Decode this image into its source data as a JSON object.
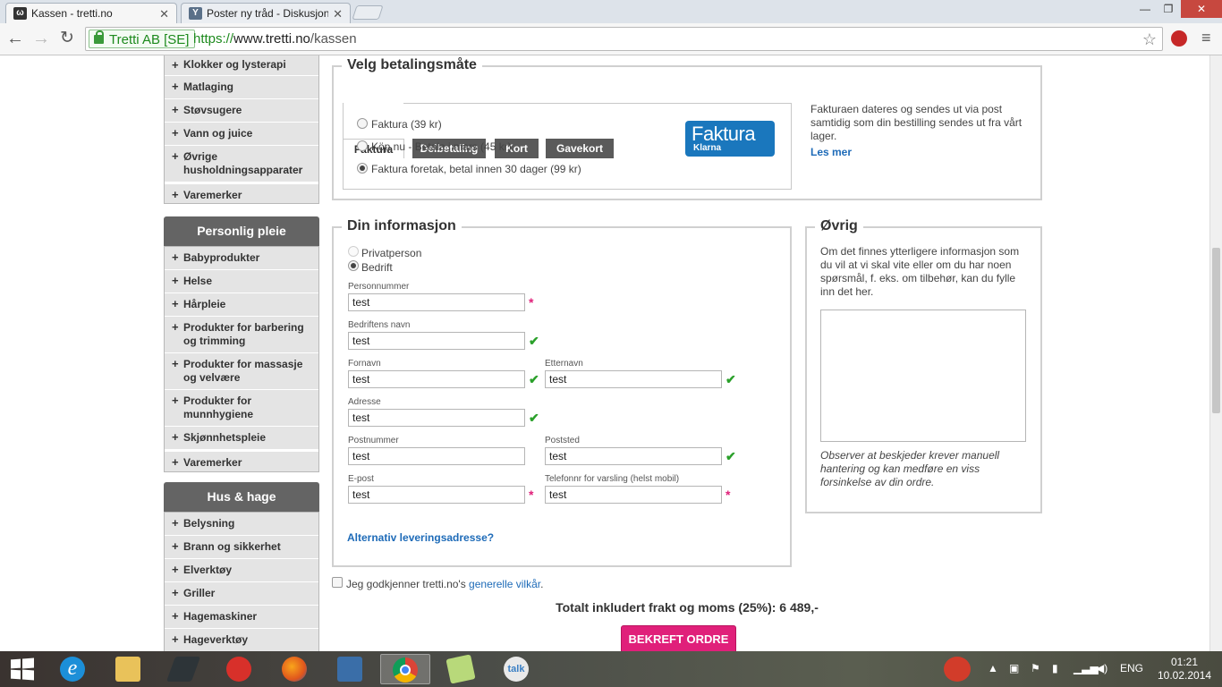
{
  "browser": {
    "tabs": [
      {
        "title": "Kassen - tretti.no",
        "active": true
      },
      {
        "title": "Poster ny tråd - Diskusjon",
        "active": false
      }
    ],
    "window_controls": {
      "minimize": "—",
      "restore": "❐",
      "close": "✕"
    },
    "address": {
      "ev_label": "Tretti AB [SE]",
      "scheme": "https://",
      "host": "www.tretti.no",
      "path": "/kassen"
    }
  },
  "sidebar": {
    "group1_items": [
      "Klokker og lysterapi",
      "Matlaging",
      "Støvsugere",
      "Vann og juice",
      "Øvrige husholdningsapparater"
    ],
    "group1_brands": "Varemerker",
    "group2_title": "Personlig pleie",
    "group2_items": [
      "Babyprodukter",
      "Helse",
      "Hårpleie",
      "Produkter for barbering og trimming",
      "Produkter for massasje og velvære",
      "Produkter for munnhygiene",
      "Skjønnhetspleie"
    ],
    "group2_brands": "Varemerker",
    "group3_title": "Hus & hage",
    "group3_items": [
      "Belysning",
      "Brann og sikkerhet",
      "Elverktøy",
      "Griller",
      "Hagemaskiner",
      "Hageverktøy"
    ]
  },
  "payment": {
    "legend": "Velg betalingsmåte",
    "tabs": [
      "Faktura",
      "Delbetaling",
      "Kort",
      "Gavekort"
    ],
    "active_tab": "Faktura",
    "options": [
      {
        "label": "Faktura (39 kr)",
        "selected": false
      },
      {
        "label": "Köp nu - Betala i mars (45 kr)",
        "selected": false
      },
      {
        "label": "Faktura foretak, betal innen 30 dager (99 kr)",
        "selected": true
      }
    ],
    "logo_title": "Faktura",
    "logo_sub": "Klarna",
    "info_text": "Fakturaen dateres og sendes ut via post samtidig som din bestilling sendes ut fra vårt lager.",
    "info_link": "Les mer"
  },
  "info": {
    "legend": "Din informasjon",
    "customer_types": [
      {
        "label": "Privatperson",
        "selected": false
      },
      {
        "label": "Bedrift",
        "selected": true
      }
    ],
    "fields": {
      "personnummer": {
        "label": "Personnummer",
        "value": "test"
      },
      "bedrift": {
        "label": "Bedriftens navn",
        "value": "test"
      },
      "fornavn": {
        "label": "Fornavn",
        "value": "test"
      },
      "etternavn": {
        "label": "Etternavn",
        "value": "test"
      },
      "adresse": {
        "label": "Adresse",
        "value": "test"
      },
      "postnummer": {
        "label": "Postnummer",
        "value": "test"
      },
      "poststed": {
        "label": "Poststed",
        "value": "test"
      },
      "epost": {
        "label": "E-post",
        "value": "test"
      },
      "telefon": {
        "label": "Telefonnr for varsling (helst mobil)",
        "value": "test"
      }
    },
    "required_mark": "*",
    "valid_mark": "✔",
    "alt_address_link": "Alternativ leveringsadresse?"
  },
  "other": {
    "legend": "Øvrig",
    "intro": "Om det finnes ytterligere informasjon som du vil at vi skal vite eller om du har noen spørsmål, f. eks. om tilbehør, kan du fylle inn det her.",
    "textarea_value": "",
    "note": "Observer at beskjeder krever manuell hantering og kan medføre en viss forsinkelse av din ordre."
  },
  "terms": {
    "prefix": "Jeg godkjenner tretti.no's ",
    "link": "generelle vilkår",
    "suffix": ".",
    "checked": false
  },
  "total": {
    "text": "Totalt inkludert frakt og moms (25%): 6 489,-"
  },
  "confirm_button": "BEKREFT ORDRE",
  "taskbar": {
    "apps": [
      "windows-start-icon",
      "internet-explorer-icon",
      "file-explorer-icon",
      "app-icon",
      "app-icon",
      "firefox-icon",
      "app-icon",
      "chrome-icon",
      "app-icon",
      "google-talk-icon"
    ],
    "talk_label": "talk",
    "language": "ENG",
    "time": "01:21",
    "date": "10.02.2014"
  },
  "colors": {
    "accent_pink": "#e0207a",
    "link_blue": "#1e6bb8",
    "ok_green": "#2aa02a",
    "klarna_blue": "#1a77bd"
  }
}
